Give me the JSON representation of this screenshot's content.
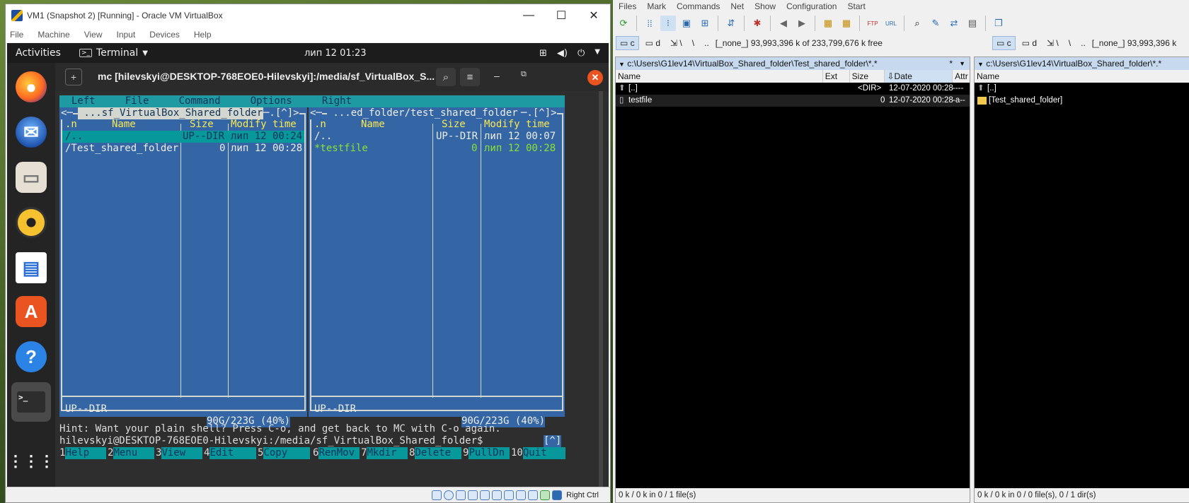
{
  "vbox": {
    "title": "VM1 (Snapshot 2) [Running] - Oracle VM VirtualBox",
    "menu": [
      "File",
      "Machine",
      "View",
      "Input",
      "Devices",
      "Help"
    ],
    "status_right": "Right Ctrl"
  },
  "ubuntu": {
    "activities": "Activities",
    "app": "Terminal",
    "clock": "лип 12  01:23"
  },
  "terminal": {
    "title": "mc [hilevskyi@DESKTOP-768EOE0-Hilevskyi]:/media/sf_VirtualBox_S...",
    "menubar": "  Left     File     Command     Options     Right",
    "left_panel": {
      "header": " ...sf_VirtualBox_Shared_folder ",
      "cols": [
        ".n",
        "Name",
        "Size",
        "Modify time"
      ],
      "rows": [
        {
          "name": "/..",
          "size": "UP--DIR",
          "time": "лип 12 00:24"
        },
        {
          "name": "/Test_shared_folder",
          "size": "0",
          "time": "лип 12 00:28"
        }
      ],
      "mini": "UP--DIR",
      "free": "90G/223G (40%)"
    },
    "right_panel": {
      "header": " ...ed_folder/test_shared_folder ",
      "cols": [
        ".n",
        "Name",
        "Size",
        "Modify time"
      ],
      "rows": [
        {
          "name": "/..",
          "size": "UP--DIR",
          "time": "лип 12 00:07"
        },
        {
          "name": "*testfile",
          "size": "0",
          "time": "лип 12 00:28"
        }
      ],
      "mini": "UP--DIR",
      "free": "90G/223G (40%)"
    },
    "hint": "Hint: Want your plain shell? Press C-o, and get back to MC with C-o again.",
    "prompt": "hilevskyi@DESKTOP-768EOE0-Hilevskyi:/media/sf_VirtualBox_Shared_folder$",
    "fkeys": [
      {
        "n": "1",
        "label": "Help"
      },
      {
        "n": "2",
        "label": "Menu"
      },
      {
        "n": "3",
        "label": "View"
      },
      {
        "n": "4",
        "label": "Edit"
      },
      {
        "n": "5",
        "label": "Copy"
      },
      {
        "n": "6",
        "label": "RenMov"
      },
      {
        "n": "7",
        "label": "Mkdir"
      },
      {
        "n": "8",
        "label": "Delete"
      },
      {
        "n": "9",
        "label": "PullDn"
      },
      {
        "n": "10",
        "label": "Quit"
      }
    ]
  },
  "tc": {
    "menu": [
      "Files",
      "Mark",
      "Commands",
      "Net",
      "Show",
      "Configuration",
      "Start"
    ],
    "left": {
      "drive_c": "c",
      "drive_d": "d",
      "drive_info": "[_none_]  93,993,396 k of 233,799,676 k free",
      "path": "c:\\Users\\G1lev14\\VirtualBox_Shared_folder\\Test_shared_folder\\*.*",
      "cols": [
        "Name",
        "Ext",
        "Size",
        "Date",
        "Attr"
      ],
      "rows": [
        {
          "name": "[..]",
          "ext": "",
          "size": "<DIR>",
          "date": "12-07-2020 00:28",
          "attr": "----"
        },
        {
          "name": "testfile",
          "ext": "",
          "size": "0",
          "date": "12-07-2020 00:28",
          "attr": "-a--"
        }
      ],
      "status": "0 k / 0 k in 0 / 1 file(s)"
    },
    "right": {
      "drive_c": "c",
      "drive_d": "d",
      "drive_info": "[_none_]  93,993,396 k",
      "path": "c:\\Users\\G1lev14\\VirtualBox_Shared_folder\\*.*",
      "cols": [
        "Name"
      ],
      "rows": [
        {
          "name": "[..]"
        },
        {
          "name": "[Test_shared_folder]"
        }
      ],
      "status": "0 k / 0 k in 0 / 0 file(s), 0 / 1 dir(s)"
    }
  }
}
